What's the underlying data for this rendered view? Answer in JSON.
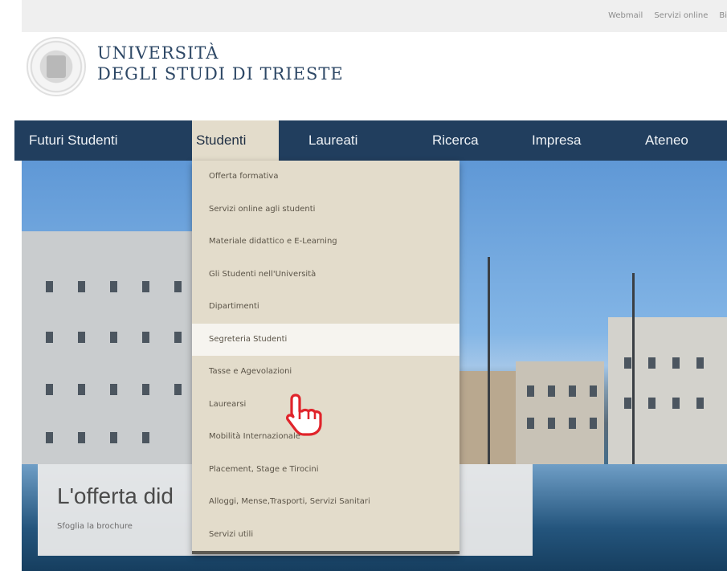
{
  "top_links": [
    "Webmail",
    "Servizi online",
    "Bi"
  ],
  "logo": {
    "line1": "UNIVERSITÀ",
    "line2": "DEGLI STUDI DI TRIESTE"
  },
  "nav": [
    "Futuri Studenti",
    "Studenti",
    "Laureati",
    "Ricerca",
    "Impresa",
    "Ateneo"
  ],
  "active_nav": "Studenti",
  "dropdown": [
    "Offerta formativa",
    "Servizi online agli studenti",
    "Materiale didattico e E-Learning",
    "Gli Studenti nell'Università",
    "Dipartimenti",
    "Segreteria Studenti",
    "Tasse e Agevolazioni",
    "Laurearsi",
    "Mobilità Internazionale",
    "Placement, Stage e Tirocini",
    "Alloggi, Mense,Trasporti, Servizi Sanitari",
    "Servizi utili"
  ],
  "highlighted_item": "Segreteria Studenti",
  "promo": {
    "title": "L'offerta did",
    "link": "Sfoglia la brochure"
  },
  "colors": {
    "nav_bg": "#213e5e",
    "dropdown_bg": "#e3dccb",
    "cursor": "#e0242b"
  },
  "cursor_icon": "hand-pointer-icon"
}
